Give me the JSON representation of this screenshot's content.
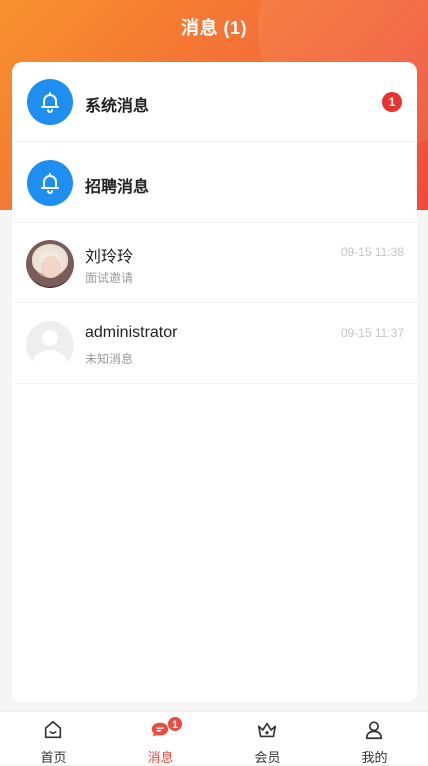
{
  "header": {
    "title": "消息 (1)"
  },
  "messages": [
    {
      "kind": "system",
      "icon": "bell-icon",
      "title": "系统消息",
      "badge": "1"
    },
    {
      "kind": "recruit",
      "icon": "bell-icon",
      "title": "招聘消息"
    },
    {
      "kind": "chat",
      "name": "刘玲玲",
      "preview": "面试邀请",
      "time": "09-15 11:38"
    },
    {
      "kind": "chat",
      "name": "administrator",
      "preview": "未知消息",
      "time": "09-15 11:37"
    }
  ],
  "tabbar": {
    "items": [
      {
        "label": "首页",
        "icon": "home-icon",
        "active": false
      },
      {
        "label": "消息",
        "icon": "chat-icon",
        "active": true,
        "badge": "1"
      },
      {
        "label": "会员",
        "icon": "crown-icon",
        "active": false
      },
      {
        "label": "我的",
        "icon": "user-icon",
        "active": false
      }
    ]
  },
  "colors": {
    "header_gradient_start": "#f7922e",
    "header_gradient_end": "#ee4b3f",
    "bell_circle": "#1e8ef0",
    "badge": "#e8322f",
    "active_tab": "#ee4b3f"
  }
}
